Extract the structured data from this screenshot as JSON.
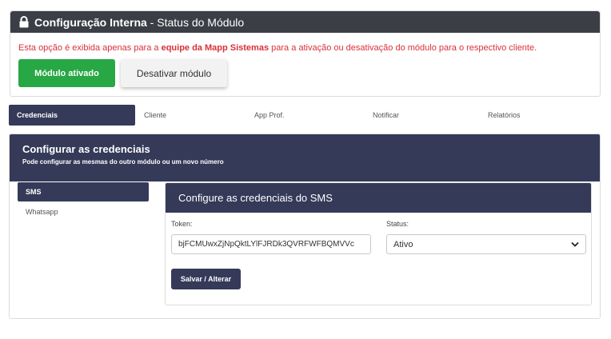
{
  "config": {
    "title": "Configuração Interna",
    "separator": " - ",
    "subtitle": "Status do Módulo",
    "warning_prefix": "Esta opção é exibida apenas para a ",
    "warning_bold": "equipe da Mapp Sistemas",
    "warning_suffix": " para a ativação ou desativação do módulo para o respectivo cliente.",
    "activated_label": "Módulo ativado",
    "deactivate_label": "Desativar módulo",
    "warning_color": "#d9303a",
    "activated_color": "#28a745"
  },
  "tabs": [
    {
      "label": "Credenciais",
      "active": true
    },
    {
      "label": "Cliente",
      "active": false
    },
    {
      "label": "App Prof.",
      "active": false
    },
    {
      "label": "Notificar",
      "active": false
    },
    {
      "label": "Relatórios",
      "active": false
    }
  ],
  "credentials": {
    "title": "Configurar as credenciais",
    "subtitle": "Pode configurar as mesmas do outro módulo ou um novo número",
    "sidebar": [
      {
        "label": "SMS",
        "active": true
      },
      {
        "label": "Whatsapp",
        "active": false
      }
    ],
    "panel": {
      "title": "Configure as credenciais do SMS",
      "token_label": "Token:",
      "token_value": "bjFCMUwxZjNpQktLYlFJRDk3QVRFWFBQMVVc",
      "status_label": "Status:",
      "status_value": "Ativo",
      "save_label": "Salvar / Alterar"
    },
    "accent_color": "#353a59"
  }
}
